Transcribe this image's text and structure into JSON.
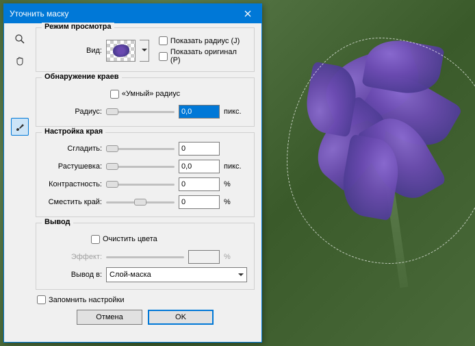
{
  "titlebar": {
    "title": "Уточнить маску"
  },
  "viewmode": {
    "legend": "Режим просмотра",
    "vid_label": "Вид:",
    "show_radius": "Показать радиус (J)",
    "show_original": "Показать оригинал (P)"
  },
  "edge": {
    "legend": "Обнаружение краев",
    "smart_radius": "«Умный» радиус",
    "radius_label": "Радиус:",
    "radius_value": "0,0",
    "radius_unit": "пикс."
  },
  "adjust": {
    "legend": "Настройка края",
    "smooth_label": "Сгладить:",
    "smooth_value": "0",
    "feather_label": "Растушевка:",
    "feather_value": "0,0",
    "feather_unit": "пикс.",
    "contrast_label": "Контрастность:",
    "contrast_value": "0",
    "contrast_unit": "%",
    "shift_label": "Сместить край:",
    "shift_value": "0",
    "shift_unit": "%"
  },
  "output": {
    "legend": "Вывод",
    "decontaminate": "Очистить цвета",
    "effect_label": "Эффект:",
    "effect_value": "",
    "effect_unit": "%",
    "output_to_label": "Вывод в:",
    "output_to_value": "Слой-маска"
  },
  "remember": "Запомнить настройки",
  "buttons": {
    "cancel": "Отмена",
    "ok": "OK"
  }
}
